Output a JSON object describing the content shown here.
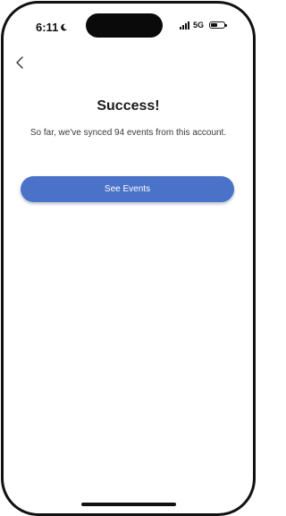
{
  "status_bar": {
    "time": "6:11",
    "network": "5G",
    "icons": [
      "moon-icon",
      "signal-icon",
      "battery-icon"
    ]
  },
  "nav": {
    "back_icon": "chevron-left-icon"
  },
  "main": {
    "title": "Success!",
    "message": "So far, we've synced 94 events from this account.",
    "button_label": "See Events"
  },
  "colors": {
    "accent": "#4a72c8",
    "text": "#1c1c1c",
    "frame": "#111111"
  }
}
